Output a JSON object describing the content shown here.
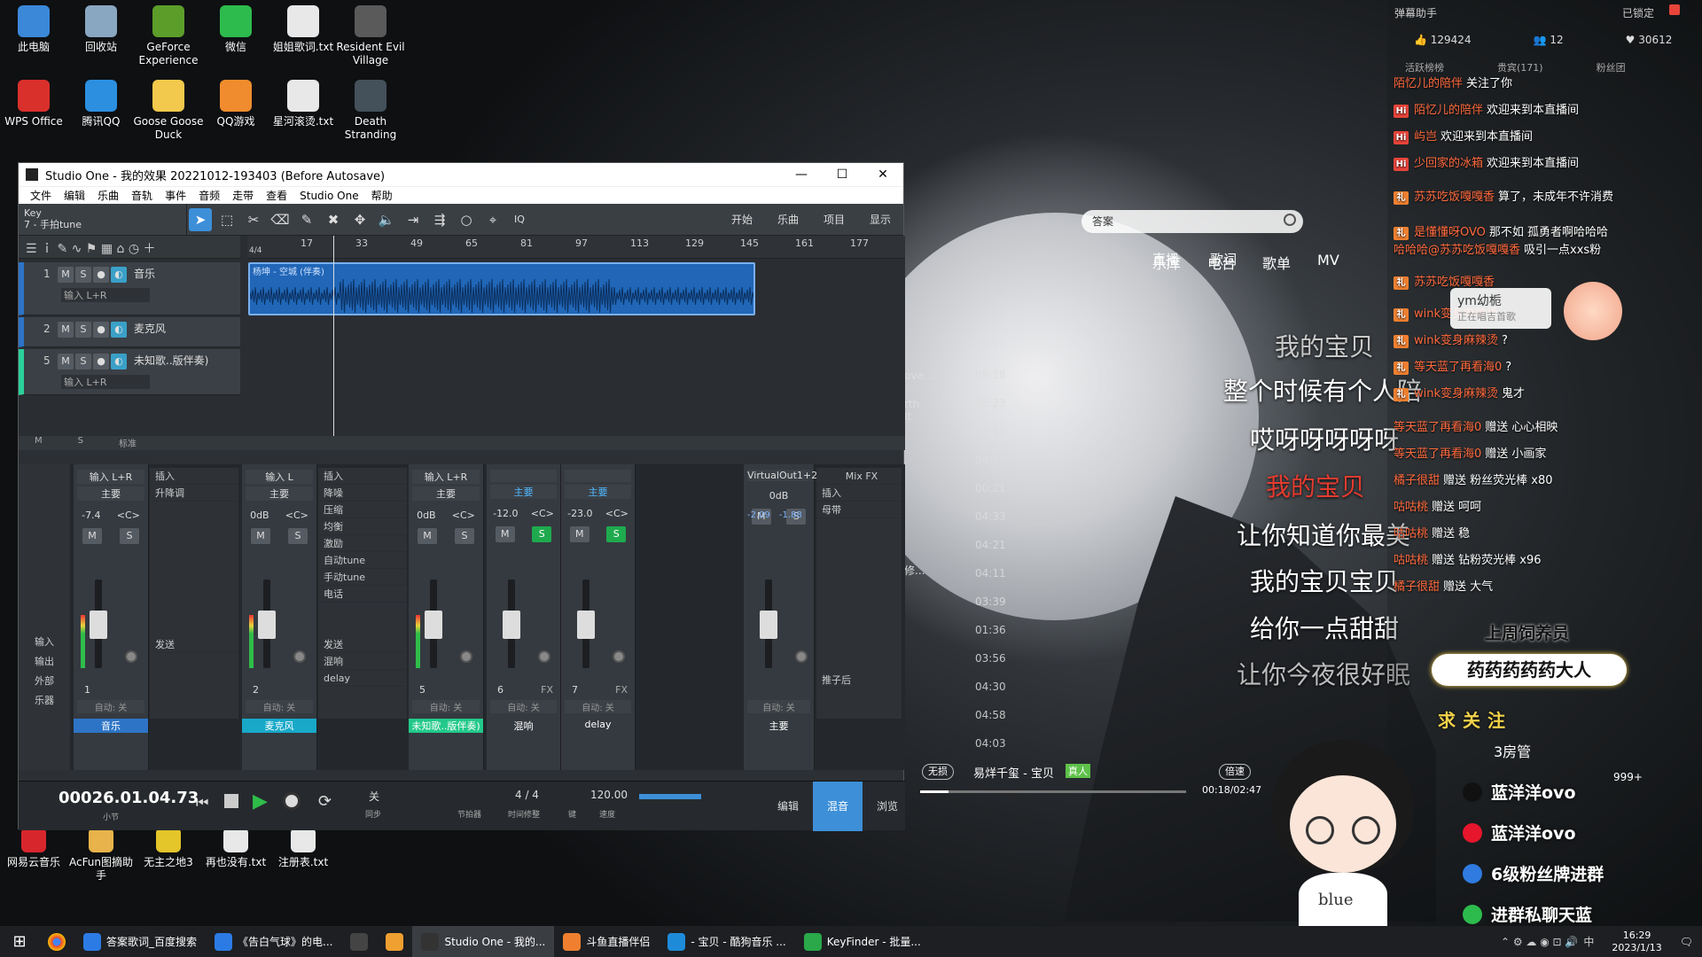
{
  "desktop": {
    "icons_top": [
      {
        "label": "此电脑",
        "color": "#3b88d9"
      },
      {
        "label": "回收站",
        "color": "#8aa7c2"
      },
      {
        "label": "GeForce Experience",
        "color": "#5c9d2a"
      },
      {
        "label": "微信",
        "color": "#2dbb4d"
      },
      {
        "label": "姐姐歌词.txt",
        "color": "#e8e8e8"
      },
      {
        "label": "Resident Evil Village",
        "color": "#5a5a5a"
      }
    ],
    "icons_row2": [
      {
        "label": "WPS Office",
        "color": "#d9302c"
      },
      {
        "label": "腾讯QQ",
        "color": "#2c8fe0"
      },
      {
        "label": "Goose Goose Duck",
        "color": "#f2c94c"
      },
      {
        "label": "QQ游戏",
        "color": "#f08c2e"
      },
      {
        "label": "星河滚烫.txt",
        "color": "#e8e8e8"
      },
      {
        "label": "Death Stranding",
        "color": "#44505a"
      }
    ],
    "icons_bottom": [
      {
        "label": "网易云音乐",
        "color": "#d8262d"
      },
      {
        "label": "AcFun图摘助手",
        "color": "#e7b34a"
      },
      {
        "label": "无主之地3",
        "color": "#e4c52a"
      },
      {
        "label": "再也没有.txt",
        "color": "#e8e8e8"
      },
      {
        "label": "注册表.txt",
        "color": "#e8e8e8"
      }
    ]
  },
  "studio_one": {
    "title": "Studio One - 我的效果 20221012-193403 (Before Autosave)",
    "menu": [
      "文件",
      "编辑",
      "乐曲",
      "音轨",
      "事件",
      "音频",
      "走带",
      "查看",
      "Studio One",
      "帮助"
    ],
    "key_label": "Key",
    "key_value": "7 - 手拍tune",
    "toolbar_buttons": [
      "开始",
      "乐曲",
      "项目",
      "显示"
    ],
    "toolbar_iq": "IQ",
    "time_sig": "4/4",
    "ruler": [
      "17",
      "33",
      "49",
      "65",
      "81",
      "97",
      "113",
      "129",
      "145",
      "161",
      "177"
    ],
    "tracks": [
      {
        "num": "1",
        "name": "音乐",
        "input": "输入 L+R"
      },
      {
        "num": "2",
        "name": "麦克风",
        "input": ""
      },
      {
        "num": "5",
        "name": "未知歌..版伴奏)",
        "input": "输入 L+R"
      }
    ],
    "clip_name": "杨坤 - 空城 (伴奏)",
    "track_footer": [
      "M",
      "S",
      "标准"
    ],
    "mixer": {
      "channels": [
        {
          "input": "输入 L+R",
          "bus": "主要",
          "vol": "-7.4",
          "pan": "<C>",
          "num": "1",
          "auto": "自动: 关",
          "name": "音乐",
          "color": "#2d74c7"
        },
        {
          "input": "输入 L",
          "bus": "主要",
          "vol": "0dB",
          "pan": "<C>",
          "num": "2",
          "auto": "自动: 关",
          "name": "麦克风",
          "color": "#18a9c9"
        },
        {
          "input": "输入 L+R",
          "bus": "主要",
          "vol": "0dB",
          "pan": "<C>",
          "num": "5",
          "auto": "自动: 关",
          "name": "未知歌..版伴奏)",
          "color": "#22c98a"
        },
        {
          "input": "",
          "bus": "主要",
          "vol": "-12.0",
          "pan": "<C>",
          "num": "6",
          "auto": "自动: 关",
          "name": "混响",
          "color": "#353a40"
        },
        {
          "input": "",
          "bus": "主要",
          "vol": "-23.0",
          "pan": "<C>",
          "num": "7",
          "auto": "自动: 关",
          "name": "delay",
          "color": "#353a40"
        },
        {
          "input": "VirtualOut1+2",
          "bus": "",
          "vol": "0dB",
          "pan": "",
          "num": "",
          "auto": "自动: 关",
          "name": "主要",
          "color": "#353a40"
        }
      ],
      "inserts_1": [
        "插入",
        "升降调"
      ],
      "inserts_2": [
        "插入",
        "降噪",
        "压缩",
        "均衡",
        "激励",
        "自动tune",
        "手动tune",
        "电话"
      ],
      "sends": "发送",
      "sends_2": [
        "发送",
        "混响",
        "delay"
      ],
      "mixfx": "Mix FX",
      "mixfx_items": [
        "插入",
        "母带"
      ],
      "post": "推子后",
      "meter_readout": [
        "-2.09",
        "-1.88"
      ],
      "side_labels": [
        "输入",
        "输出",
        "外部",
        "乐器"
      ],
      "fx_label": "FX"
    },
    "transport": {
      "time": "00026.01.04.73",
      "time_unit": "小节",
      "sync": "关",
      "sync_label": "同步",
      "metronome": "节拍器",
      "sig": "4 / 4",
      "sig_label": "时间修整",
      "key_label": "键",
      "tempo": "120.00",
      "tempo_label": "速度",
      "tabs": [
        "编辑",
        "混音",
        "浏览"
      ]
    }
  },
  "music_player": {
    "search_placeholder": "答案",
    "nav": [
      "乐库",
      "电台",
      "歌单",
      "MV",
      "直播",
      "歌词"
    ],
    "durations": [
      "03:12",
      "03:12",
      "05:28",
      "03:23",
      "03:11",
      "04:33",
      "00:21",
      "04:33",
      "04:21",
      "04:11",
      "03:39",
      "01:36",
      "03:56",
      "04:30",
      "04:58",
      "04:03"
    ],
    "song_fragments": [
      "ove...",
      "rth It",
      "修..."
    ],
    "now_playing": "易烊千玺 - 宝贝",
    "badge": "真人",
    "mode": "无损",
    "speed": "倍速",
    "time": "00:18/02:47",
    "lyrics": [
      {
        "text": "我的宝贝",
        "color": "#c9c9c9"
      },
      {
        "text": "整个时候有个人陪",
        "color": "#ffffff"
      },
      {
        "text": "哎呀呀呀呀呀",
        "color": "#ffffff"
      },
      {
        "text": "我的宝贝",
        "color": "#e33b2f"
      },
      {
        "text": "让你知道你最美",
        "color": "#ffffff"
      },
      {
        "text": "我的宝贝宝贝",
        "color": "#ffffff"
      },
      {
        "text": "给你一点甜甜",
        "color": "#ffffff"
      },
      {
        "text": "让你今夜很好眠",
        "color": "#bdbdbd"
      }
    ]
  },
  "stream_panel": {
    "title": "弹幕助手",
    "lock": "已锁定",
    "stats": {
      "likes": "129424",
      "viewers": "12",
      "fans": "30612"
    },
    "tabs": [
      "活跃榜榜",
      "贵宾(171)",
      "粉丝团"
    ],
    "chat": [
      {
        "user": "陌忆儿的陪伴",
        "msg": "关注了你",
        "type": "plain"
      },
      {
        "user": "陌忆儿的陪伴",
        "msg": "欢迎来到本直播间",
        "type": "hi"
      },
      {
        "user": "屿岂",
        "msg": "欢迎来到本直播间",
        "type": "hi"
      },
      {
        "user": "少回家的冰箱",
        "msg": "欢迎来到本直播间",
        "type": "hi"
      },
      {
        "user": "苏苏吃饭嘎嘎香",
        "msg": "算了，未成年不许消费",
        "type": "gift"
      },
      {
        "user": "是懂懂呀OVO",
        "msg": "那不如 孤勇者啊哈哈哈",
        "type": "gift"
      },
      {
        "user": "哈哈哈@苏苏吃饭嘎嘎香",
        "msg": "吸引一点xxs粉",
        "type": "plain"
      },
      {
        "user": "苏苏吃饭嘎嘎香",
        "msg": "",
        "type": "gift"
      },
      {
        "user": "wink变身麻辣烫",
        "msg": "",
        "type": "gift"
      },
      {
        "user": "wink变身麻辣烫",
        "msg": "?",
        "type": "gift"
      },
      {
        "user": "等天蓝了再看海0",
        "msg": "?",
        "type": "gift"
      },
      {
        "user": "wink变身麻辣烫",
        "msg": "鬼才",
        "type": "gift"
      },
      {
        "user": "等天蓝了再看海0",
        "msg": "赠送 心心相映",
        "type": "plain"
      },
      {
        "user": "等天蓝了再看海0",
        "msg": "赠送 小画家",
        "type": "plain"
      },
      {
        "user": "橘子很甜",
        "msg": "赠送 粉丝荧光棒 x80",
        "type": "plain"
      },
      {
        "user": "咕咕桃",
        "msg": "赠送 呵呵",
        "type": "plain"
      },
      {
        "user": "咕咕桃",
        "msg": "赠送 稳",
        "type": "plain"
      },
      {
        "user": "咕咕桃",
        "msg": "赠送 钻粉荧光棒 x96",
        "type": "plain"
      },
      {
        "user": "橘子很甜",
        "msg": "赠送 大气",
        "type": "plain"
      }
    ],
    "popup": {
      "name": "ym幼栀",
      "status": "正在唱吉首歌"
    },
    "banner_week": "上周饲养员",
    "banner_name": "药药药药药大人",
    "follow": "求关注",
    "rank": "3房管",
    "rank_count": "999+",
    "social": [
      {
        "icon": "douyin",
        "text": "蓝洋洋ovo"
      },
      {
        "icon": "weibo",
        "text": "蓝洋洋ovo"
      },
      {
        "icon": "fans",
        "text": "6级粉丝牌进群"
      },
      {
        "icon": "wechat",
        "text": "进群私聊天蓝"
      }
    ],
    "avatar_text": "blue"
  },
  "taskbar": {
    "items": [
      {
        "label": "答案歌词_百度搜索",
        "color": "#2c7be5"
      },
      {
        "label": "《告白气球》的电...",
        "color": "#2c7be5"
      },
      {
        "label": "",
        "color": "#444"
      },
      {
        "label": "",
        "color": "#f0a030"
      },
      {
        "label": "Studio One - 我的...",
        "color": "#333"
      },
      {
        "label": "斗鱼直播伴侣",
        "color": "#f08030"
      },
      {
        "label": "- 宝贝 - 酷狗音乐 ...",
        "color": "#1e8bd9"
      },
      {
        "label": "KeyFinder - 批量...",
        "color": "#2aa84a"
      }
    ],
    "ime": "中",
    "time": "16:29",
    "date": "2023/1/13"
  }
}
